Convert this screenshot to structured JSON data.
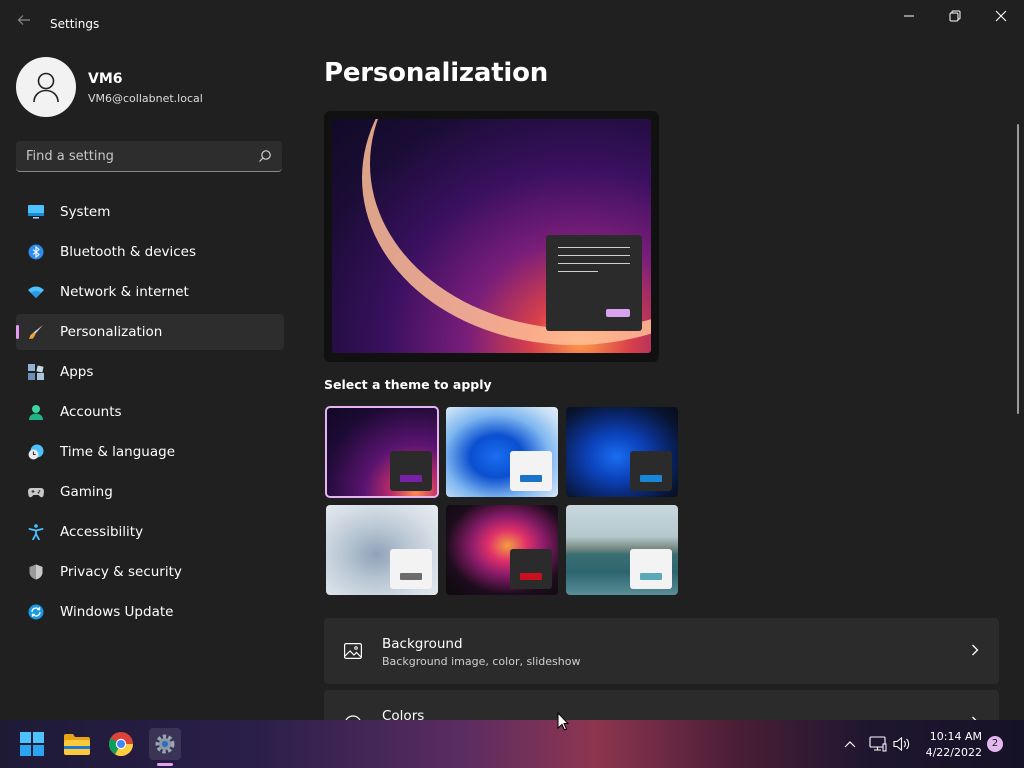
{
  "window": {
    "title": "Settings",
    "controls": [
      "minimize-icon",
      "restore-icon",
      "close-icon"
    ]
  },
  "user": {
    "name": "VM6",
    "email": "VM6@collabnet.local"
  },
  "search": {
    "placeholder": "Find a setting"
  },
  "sidebar": {
    "items": [
      {
        "label": "System",
        "icon": "system-icon",
        "active": false
      },
      {
        "label": "Bluetooth & devices",
        "icon": "bluetooth-icon",
        "active": false
      },
      {
        "label": "Network & internet",
        "icon": "wifi-icon",
        "active": false
      },
      {
        "label": "Personalization",
        "icon": "brush-icon",
        "active": true
      },
      {
        "label": "Apps",
        "icon": "apps-icon",
        "active": false
      },
      {
        "label": "Accounts",
        "icon": "accounts-icon",
        "active": false
      },
      {
        "label": "Time & language",
        "icon": "clock-globe-icon",
        "active": false
      },
      {
        "label": "Gaming",
        "icon": "gamepad-icon",
        "active": false
      },
      {
        "label": "Accessibility",
        "icon": "accessibility-icon",
        "active": false
      },
      {
        "label": "Privacy & security",
        "icon": "shield-icon",
        "active": false
      },
      {
        "label": "Windows Update",
        "icon": "update-icon",
        "active": false
      }
    ]
  },
  "main": {
    "title": "Personalization",
    "themes_label": "Select a theme to apply",
    "themes": [
      {
        "id": "windows-dark-glow",
        "selected": true,
        "accent": "#7a1fa8"
      },
      {
        "id": "windows-light-bloom",
        "selected": false,
        "accent": "#1a73c8"
      },
      {
        "id": "windows-dark-bloom",
        "selected": false,
        "accent": "#1a86d8"
      },
      {
        "id": "captured-motion",
        "selected": false,
        "accent": "#6c6c6c"
      },
      {
        "id": "flow",
        "selected": false,
        "accent": "#c81020"
      },
      {
        "id": "sunrise",
        "selected": false,
        "accent": "#5aa8b8"
      }
    ],
    "cards": [
      {
        "title": "Background",
        "subtitle": "Background image, color, slideshow",
        "icon": "image-icon"
      },
      {
        "title": "Colors",
        "subtitle": "",
        "icon": "palette-icon"
      }
    ]
  },
  "taskbar": {
    "apps": [
      "start-icon",
      "file-explorer-icon",
      "chrome-icon",
      "settings-icon"
    ],
    "active_app": "settings-icon",
    "tray": [
      "chevron-up-icon",
      "network-icon",
      "volume-icon"
    ],
    "time": "10:14 AM",
    "date": "4/22/2022",
    "notification_count": "2"
  },
  "colors": {
    "accent": "#e19bf0",
    "background": "#202020",
    "card": "#2b2b2b"
  }
}
